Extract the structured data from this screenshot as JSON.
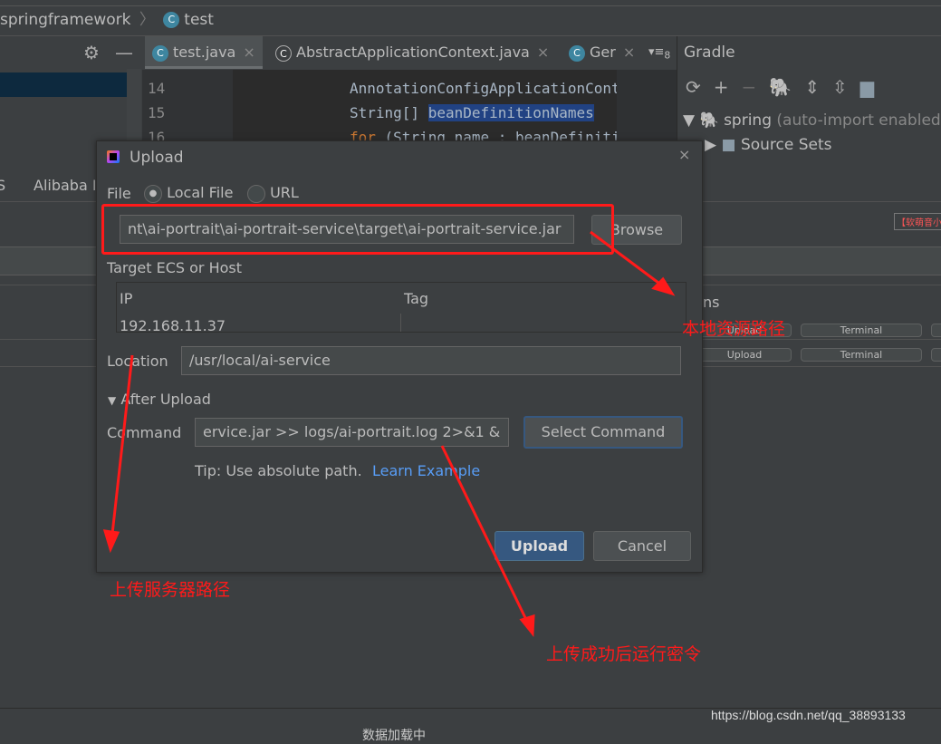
{
  "breadcrumb": {
    "items": [
      "springframework",
      "test"
    ]
  },
  "editor": {
    "tabs": [
      {
        "label": "test.java",
        "active": true
      },
      {
        "label": "AbstractApplicationContext.java",
        "active": false
      },
      {
        "label": "Ger",
        "active": false
      }
    ],
    "tab_overflow": "8",
    "lines": [
      {
        "number": "14",
        "code": "AnnotationConfigApplicationCont"
      },
      {
        "number": "15",
        "code_prefix": "String[] ",
        "code_highlight": "beanDefinitionNames"
      },
      {
        "number": "16",
        "code_keyword": "for",
        "code": " (String name : beanDefiniti"
      }
    ]
  },
  "gradle": {
    "title": "Gradle",
    "project": "spring",
    "project_note": "(auto-import enabled)",
    "children": [
      "Source Sets"
    ]
  },
  "background": {
    "tab_fragment": "S",
    "alibaba_tab": "Alibaba I",
    "right_badge": "【软萌音小",
    "right_header": "ns",
    "row_buttons": [
      [
        "Upload",
        "Terminal"
      ],
      [
        "Upload",
        "Terminal"
      ]
    ],
    "bottom_text": "数据加载中"
  },
  "dialog": {
    "title": "Upload",
    "file_label": "File",
    "radio_local": "Local File",
    "radio_url": "URL",
    "selected_source": "Local File",
    "file_path": "nt\\ai-portrait\\ai-portrait-service\\target\\ai-portrait-service.jar",
    "browse": "Browse",
    "target_label": "Target ECS or Host",
    "table": {
      "headers": [
        "IP",
        "Tag"
      ],
      "rows": [
        [
          "192.168.11.37",
          ""
        ]
      ]
    },
    "location_label": "Location",
    "location": "/usr/local/ai-service",
    "after_upload": "After Upload",
    "command_label": "Command",
    "command": "ervice.jar >> logs/ai-portrait.log 2>&1 &",
    "select_command": "Select Command",
    "tip": "Tip: Use absolute path.",
    "learn_example": "Learn Example",
    "upload": "Upload",
    "cancel": "Cancel"
  },
  "annotations": {
    "local_path": "本地资源路径",
    "server_path": "上传服务器路径",
    "run_command": "上传成功后运行密令"
  },
  "watermark": "https://blog.csdn.net/qq_38893133",
  "colors": {
    "accent": "#365880",
    "link": "#589df6",
    "annotation": "#ff1a1a",
    "background": "#3c3f41",
    "editor": "#2b2b2b"
  }
}
